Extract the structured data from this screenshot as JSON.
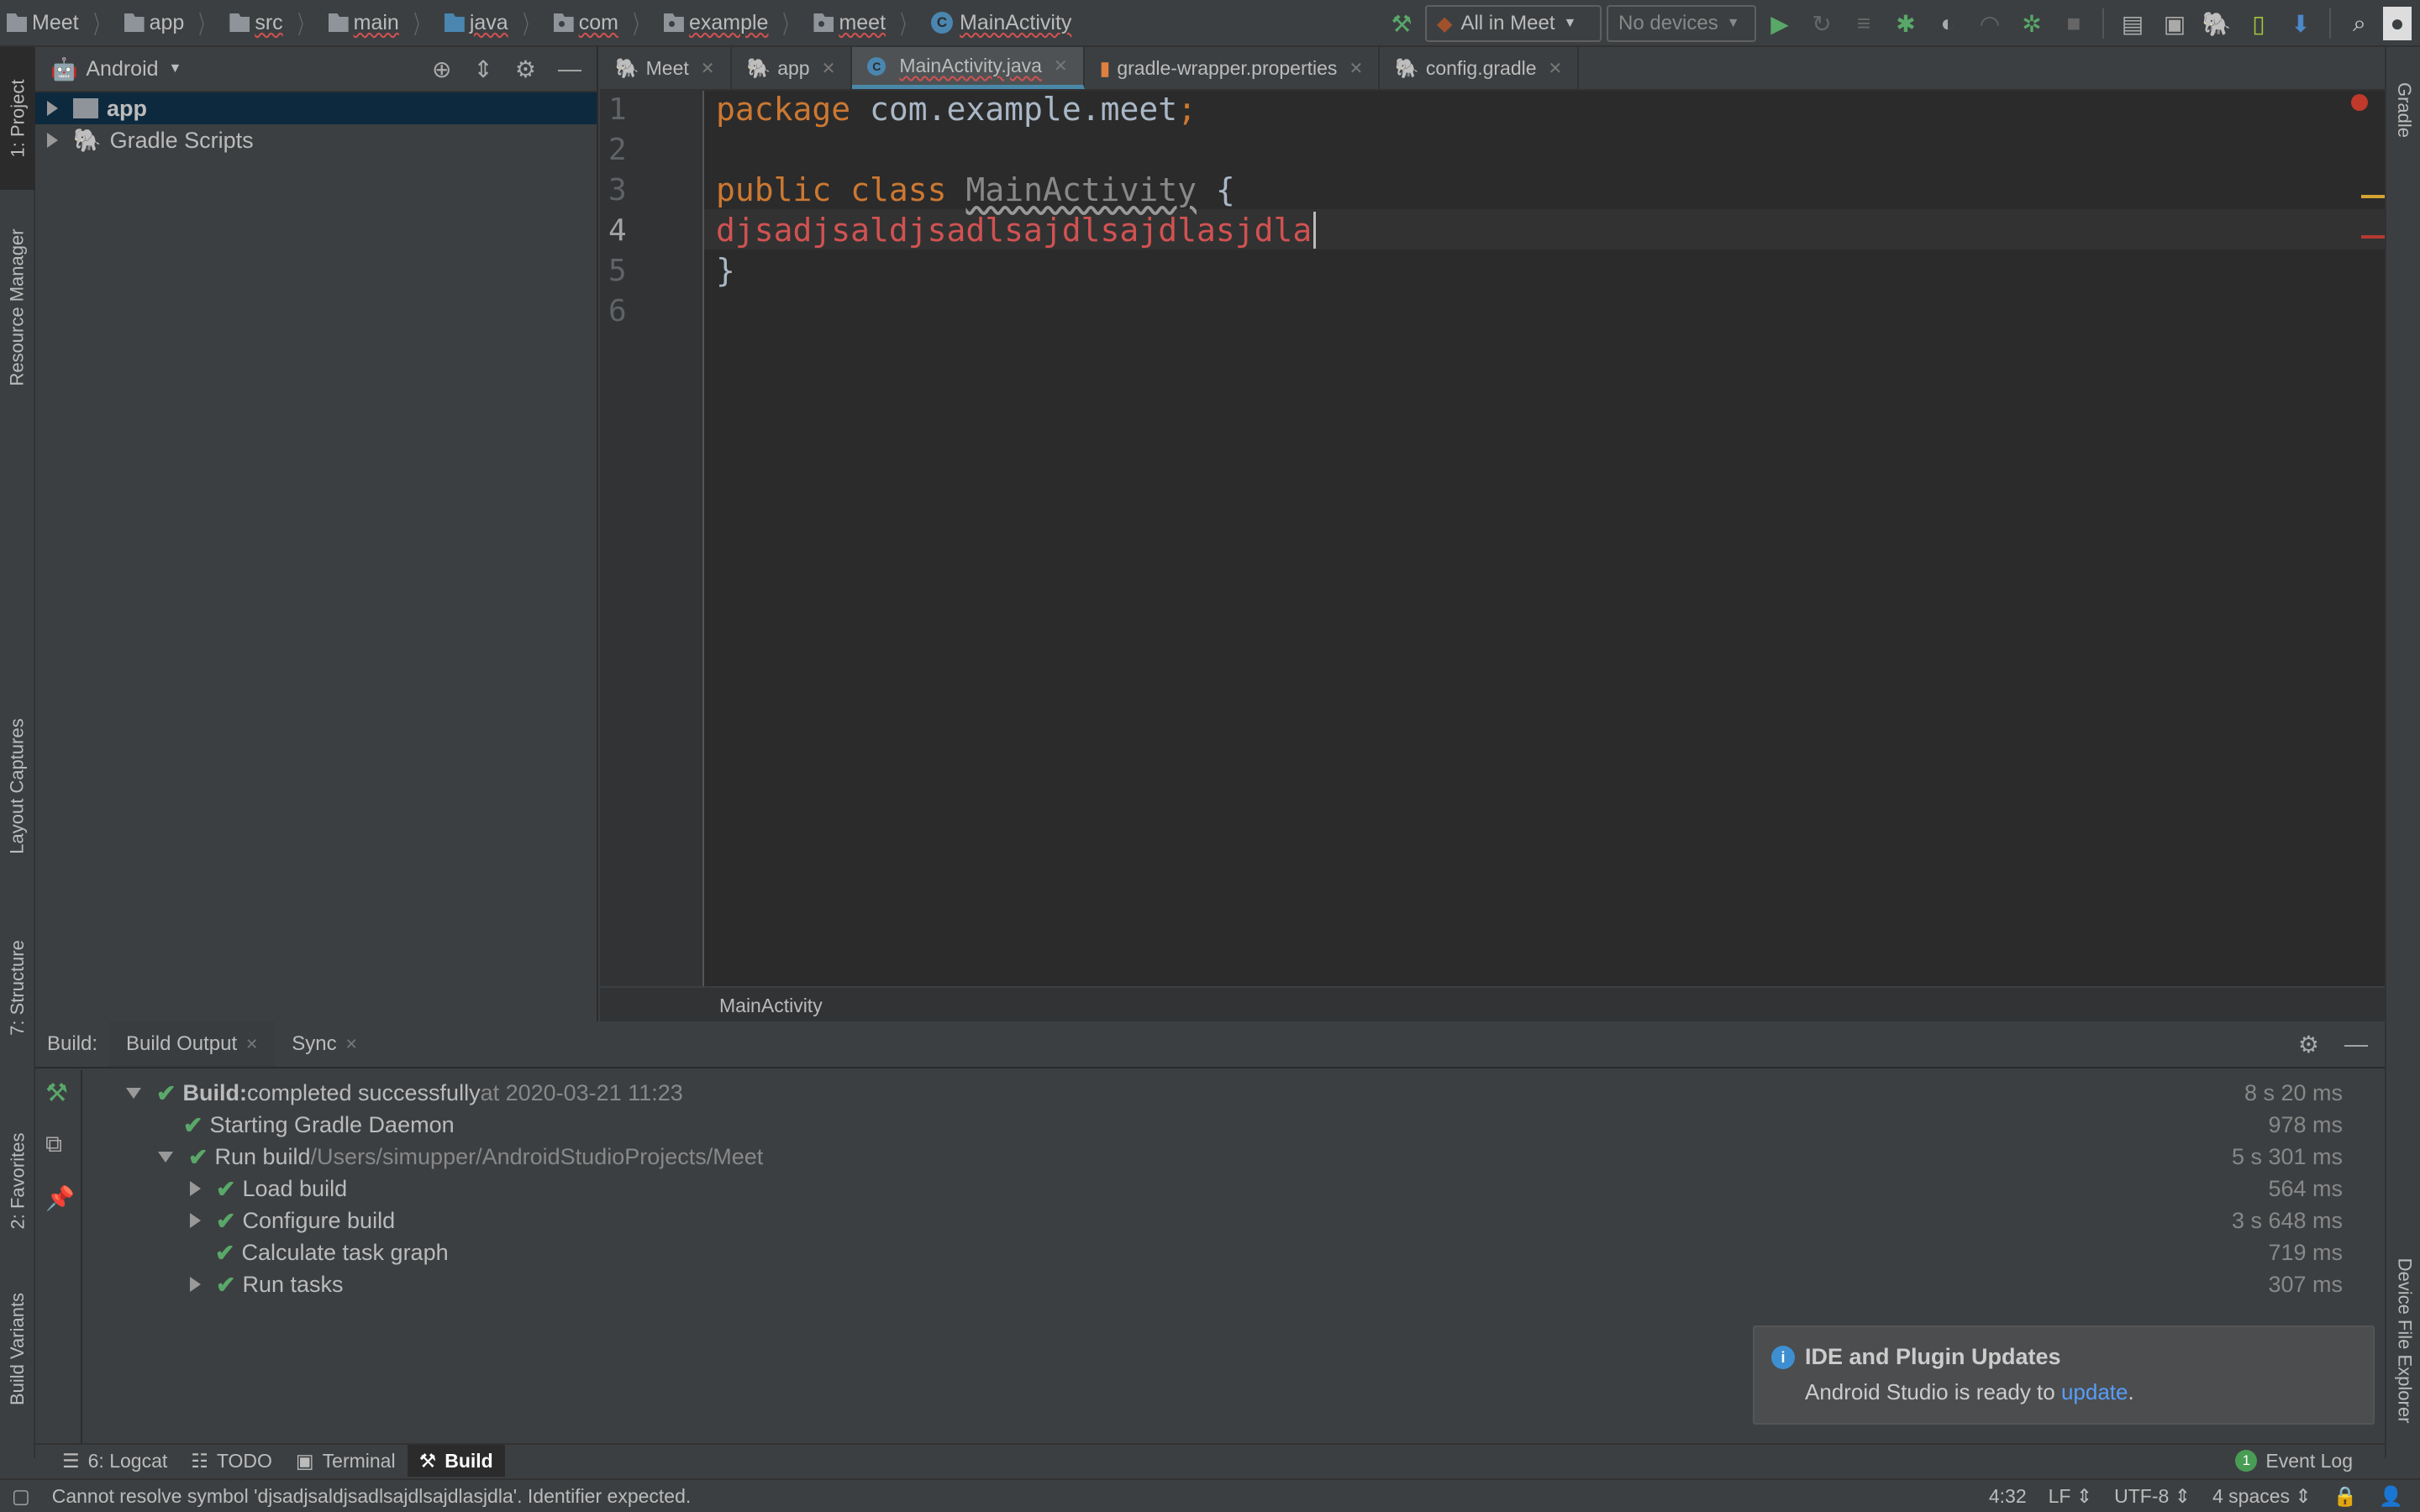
{
  "navbar": {
    "breadcrumbs": [
      {
        "label": "Meet",
        "icon": "project-folder-icon"
      },
      {
        "label": "app",
        "icon": "module-folder-icon"
      },
      {
        "label": "src",
        "icon": "folder-icon"
      },
      {
        "label": "main",
        "icon": "folder-icon"
      },
      {
        "label": "java",
        "icon": "source-folder-icon"
      },
      {
        "label": "com",
        "icon": "package-icon"
      },
      {
        "label": "example",
        "icon": "package-icon"
      },
      {
        "label": "meet",
        "icon": "package-icon"
      },
      {
        "label": "MainActivity",
        "icon": "class-icon"
      }
    ]
  },
  "toolbar": {
    "run_config": "All in Meet",
    "device": "No devices"
  },
  "left_stripe": {
    "project": "1: Project",
    "resource_manager": "Resource Manager",
    "layout_captures": "Layout Captures",
    "structure": "7: Structure",
    "favorites": "2: Favorites",
    "build_variants": "Build Variants"
  },
  "right_stripe": {
    "gradle": "Gradle",
    "device_file_explorer": "Device File Explorer"
  },
  "project_pane": {
    "view": "Android",
    "tree": [
      {
        "label": "app",
        "selected": true
      },
      {
        "label": "Gradle Scripts",
        "selected": false
      }
    ]
  },
  "editor": {
    "tabs": [
      {
        "label": "Meet",
        "active": false
      },
      {
        "label": "app",
        "active": false
      },
      {
        "label": "MainActivity.java",
        "active": true
      },
      {
        "label": "gradle-wrapper.properties",
        "active": false
      },
      {
        "label": "config.gradle",
        "active": false
      }
    ],
    "line_numbers": [
      "1",
      "2",
      "3",
      "4",
      "5",
      "6"
    ],
    "lines": {
      "l1_kw": "package",
      "l1_rest": " com.example.meet",
      "l1_semi": ";",
      "l3_kw": "public class",
      "l3_cls": "MainActivity",
      "l3_rest": " {",
      "l4_err": "djsadjsaldjsadlsajdlsajdlasjdla",
      "l5": "}"
    },
    "breadcrumb": "MainActivity"
  },
  "build": {
    "label": "Build:",
    "tabs": [
      "Build Output",
      "Sync"
    ],
    "rows": [
      {
        "bold": "Build:",
        "text": " completed successfully",
        "dim": " at 2020-03-21 11:23",
        "time": "8 s 20 ms"
      },
      {
        "text": "Starting Gradle Daemon",
        "time": "978 ms"
      },
      {
        "text": "Run build",
        "dim": " /Users/simupper/AndroidStudioProjects/Meet",
        "time": "5 s 301 ms"
      },
      {
        "text": "Load build",
        "time": "564 ms"
      },
      {
        "text": "Configure build",
        "time": "3 s 648 ms"
      },
      {
        "text": "Calculate task graph",
        "time": "719 ms"
      },
      {
        "text": "Run tasks",
        "time": "307 ms"
      }
    ]
  },
  "notification": {
    "title": "IDE and Plugin Updates",
    "body": "Android Studio is ready to ",
    "link": "update",
    "end": "."
  },
  "bottom_tools": {
    "logcat": "6: Logcat",
    "todo": "TODO",
    "terminal": "Terminal",
    "build": "Build",
    "event_log_count": "1",
    "event_log": "Event Log"
  },
  "status": {
    "message": "Cannot resolve symbol 'djsadjsaldjsadlsajdlsajdlasjdla'. Identifier expected.",
    "position": "4:32",
    "line_sep": "LF",
    "encoding": "UTF-8",
    "indent": "4 spaces"
  },
  "colors": {
    "keyword": "#cc7832",
    "error": "#d25252",
    "success": "#59a869",
    "accent": "#4a88a8",
    "link": "#589df6"
  }
}
